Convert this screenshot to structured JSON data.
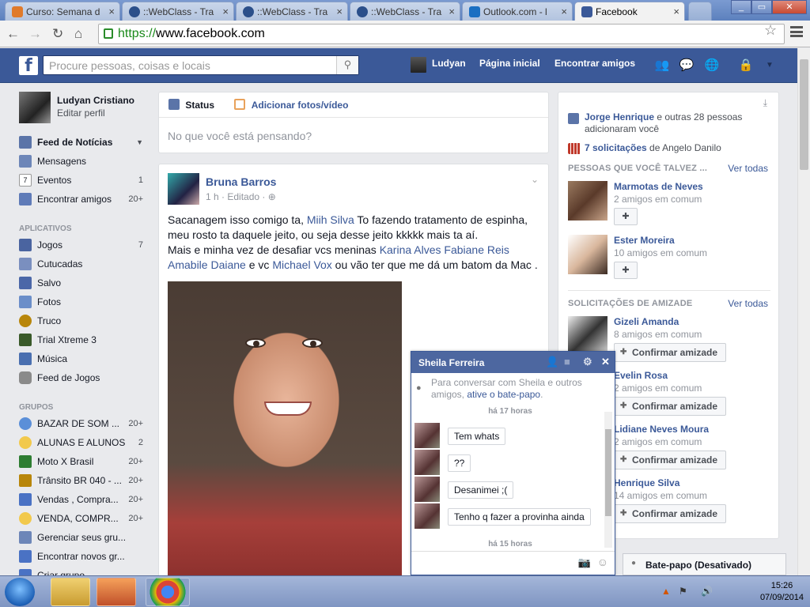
{
  "browser": {
    "tabs": [
      {
        "label": "Curso: Semana d",
        "active": false
      },
      {
        "label": "::WebClass - Tra",
        "active": false
      },
      {
        "label": "::WebClass - Tra",
        "active": false
      },
      {
        "label": "::WebClass - Tra",
        "active": false
      },
      {
        "label": "Outlook.com - l",
        "active": false
      },
      {
        "label": "Facebook",
        "active": true
      }
    ],
    "url_scheme": "https://",
    "url_rest": "www.facebook.com"
  },
  "fb": {
    "search_placeholder": "Procure pessoas, coisas e locais",
    "nav_user": "Ludyan",
    "nav_home": "Página inicial",
    "nav_friends": "Encontrar amigos",
    "accent": "#3b5998"
  },
  "left": {
    "user_name": "Ludyan Cristiano",
    "edit_profile": "Editar perfil",
    "main": [
      {
        "label": "Feed de Notícias",
        "count": "",
        "icon": "news-feed-icon"
      },
      {
        "label": "Mensagens",
        "count": "",
        "icon": "messages-icon"
      },
      {
        "label": "Eventos",
        "count": "1",
        "icon": "calendar-icon"
      },
      {
        "label": "Encontrar amigos",
        "count": "20+",
        "icon": "friends-icon"
      }
    ],
    "apps_heading": "APLICATIVOS",
    "apps": [
      {
        "label": "Jogos",
        "count": "7"
      },
      {
        "label": "Cutucadas",
        "count": ""
      },
      {
        "label": "Salvo",
        "count": ""
      },
      {
        "label": "Fotos",
        "count": ""
      },
      {
        "label": "Truco",
        "count": ""
      },
      {
        "label": "Trial Xtreme 3",
        "count": ""
      },
      {
        "label": "Música",
        "count": ""
      },
      {
        "label": "Feed de Jogos",
        "count": ""
      }
    ],
    "groups_heading": "GRUPOS",
    "groups": [
      {
        "label": "BAZAR DE SOM ...",
        "count": "20+"
      },
      {
        "label": "ALUNAS E ALUNOS",
        "count": "2"
      },
      {
        "label": "Moto X Brasil",
        "count": "20+"
      },
      {
        "label": "Trânsito BR 040 - ...",
        "count": "20+"
      },
      {
        "label": "Vendas , Compra...",
        "count": "20+"
      },
      {
        "label": "VENDA, COMPR...",
        "count": "20+"
      },
      {
        "label": "Gerenciar seus gru...",
        "count": ""
      },
      {
        "label": "Encontrar novos gr...",
        "count": ""
      },
      {
        "label": "Criar grupo",
        "count": ""
      }
    ]
  },
  "composer": {
    "status_tab": "Status",
    "photo_tab": "Adicionar fotos/vídeo",
    "placeholder": "No que você está pensando?"
  },
  "post": {
    "author": "Bruna Barros",
    "meta": "1 h · Editado ·",
    "t1": "Sacanagem isso comigo ta, ",
    "l1": "Miih Silva",
    "t2": " To fazendo tratamento de espinha, meu rosto ta daquele jeito, ou seja desse jeito kkkkk mais ta aí.",
    "t3": "Mais e minha vez de desafiar vcs meninas ",
    "l2": "Karina Alves Fabiane Reis Amabile Daiane",
    "t4": " e vc ",
    "l3": "Michael Vox",
    "t5": " ou vão ter que me dá um batom da Mac ."
  },
  "right": {
    "n1_name": "Jorge Henrique",
    "n1_text": " e outras 28 pessoas adicionaram você",
    "n2_bold": "7 solicitações",
    "n2_text": " de Angelo Danilo",
    "pymk_heading": "PESSOAS QUE VOCÊ TALVEZ ...",
    "see_all": "Ver todas",
    "pymk": [
      {
        "name": "Marmotas de Neves",
        "mutual": "2 amigos em comum"
      },
      {
        "name": "Ester Moreira",
        "mutual": "10 amigos em comum"
      }
    ],
    "requests_heading": "SOLICITAÇÕES DE AMIZADE",
    "confirm_label": "Confirmar amizade",
    "requests": [
      {
        "name": "Gizeli Amanda",
        "mutual": "8 amigos em comum"
      },
      {
        "name": "Evelin Rosa",
        "mutual": "2 amigos em comum"
      },
      {
        "name": "Lidiane Neves Moura",
        "mutual": "2 amigos em comum"
      },
      {
        "name": "Henrique Silva",
        "mutual": "14 amigos em comum"
      }
    ]
  },
  "chat": {
    "title": "Sheila Ferreira",
    "info_text": "Para conversar com Sheila e outros amigos, ",
    "info_link": "ative o bate-papo",
    "sep1": "há 17 horas",
    "sep2": "há 15 horas",
    "messages": [
      "Tem whats",
      "??",
      "Desanimei ;(",
      "Tenho q fazer a provinha ainda"
    ],
    "bar_label": "Bate-papo (Desativado)"
  },
  "taskbar": {
    "time": "15:26",
    "date": "07/09/2014"
  }
}
